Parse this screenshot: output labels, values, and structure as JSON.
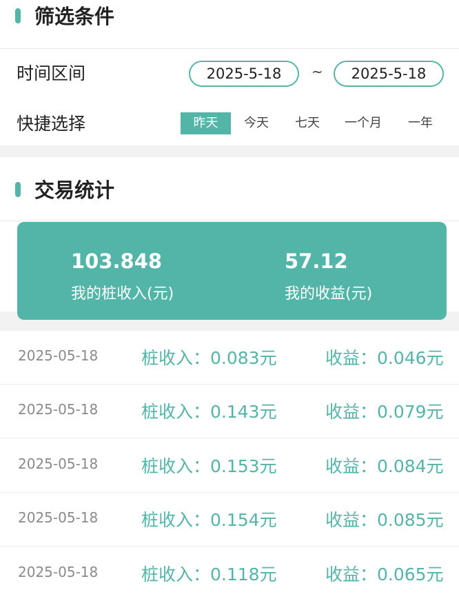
{
  "filter": {
    "title": "筛选条件",
    "time_label": "时间区间",
    "start_date": "2025-5-18",
    "separator": "~",
    "end_date": "2025-5-18",
    "quick_label": "快捷选择",
    "quick_options": [
      "昨天",
      "今天",
      "七天",
      "一个月",
      "一年"
    ],
    "active_option": "昨天"
  },
  "stats": {
    "title": "交易统计",
    "pile_income_value": "103.848",
    "pile_income_label": "我的桩收入(元)",
    "profit_value": "57.12",
    "profit_label": "我的收益(元)"
  },
  "records": [
    {
      "date": "2025-05-18",
      "income": "桩收入：0.083元",
      "profit": "收益：0.046元"
    },
    {
      "date": "2025-05-18",
      "income": "桩收入：0.143元",
      "profit": "收益：0.079元"
    },
    {
      "date": "2025-05-18",
      "income": "桩收入：0.153元",
      "profit": "收益：0.084元"
    },
    {
      "date": "2025-05-18",
      "income": "桩收入：0.154元",
      "profit": "收益：0.085元"
    },
    {
      "date": "2025-05-18",
      "income": "桩收入：0.118元",
      "profit": "收益：0.065元"
    }
  ],
  "colors": {
    "accent": "#52b5a8",
    "divider": "#f2f2f2"
  }
}
